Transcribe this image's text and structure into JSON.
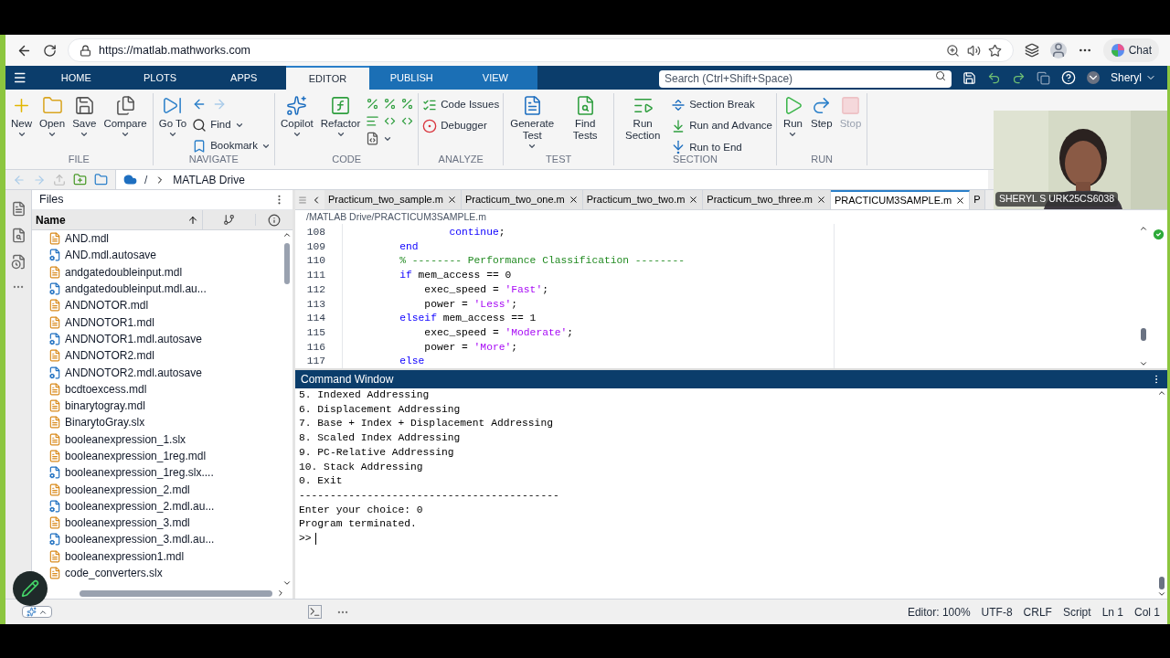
{
  "browser": {
    "url": "https://matlab.mathworks.com",
    "chat": "Chat"
  },
  "toolstrip": {
    "tabs": [
      {
        "label": "HOME",
        "selected": false,
        "contextual": false
      },
      {
        "label": "PLOTS",
        "selected": false,
        "contextual": false
      },
      {
        "label": "APPS",
        "selected": false,
        "contextual": false
      },
      {
        "label": "EDITOR",
        "selected": true,
        "contextual": true
      },
      {
        "label": "PUBLISH",
        "selected": false,
        "contextual": true
      },
      {
        "label": "VIEW",
        "selected": false,
        "contextual": true
      }
    ],
    "search": {
      "placeholder": "Search (Ctrl+Shift+Space)"
    },
    "user": "Sheryl"
  },
  "ribbon": [
    {
      "title": "FILE",
      "items": [
        {
          "kind": "large",
          "label": "New",
          "dropdown": true,
          "disabled": false
        },
        {
          "kind": "large",
          "label": "Open",
          "dropdown": true,
          "disabled": false
        },
        {
          "kind": "large",
          "label": "Save",
          "dropdown": true,
          "disabled": false
        },
        {
          "kind": "large",
          "label": "Compare",
          "dropdown": true,
          "disabled": false
        }
      ]
    },
    {
      "title": "NAVIGATE",
      "items": [
        {
          "kind": "large",
          "label": "Go To",
          "dropdown": true,
          "disabled": false
        },
        {
          "kind": "arrows",
          "dropdown": false,
          "disabled": false
        },
        {
          "kind": "small",
          "label": "Find",
          "dropdown": true,
          "disabled": false
        },
        {
          "kind": "small",
          "label": "Bookmark",
          "dropdown": true,
          "disabled": false
        }
      ]
    },
    {
      "title": "CODE",
      "items": [
        {
          "kind": "large",
          "label": "Copilot",
          "dropdown": true,
          "disabled": false
        },
        {
          "kind": "large",
          "label": "Refactor",
          "dropdown": true,
          "disabled": false
        },
        {
          "kind": "grid",
          "dropdown": true,
          "disabled": false
        }
      ]
    },
    {
      "title": "ANALYZE",
      "items": [
        {
          "kind": "small",
          "label": "Code Issues",
          "dropdown": false,
          "disabled": false
        },
        {
          "kind": "small",
          "label": "Debugger",
          "dropdown": false,
          "disabled": false
        }
      ]
    },
    {
      "title": "TEST",
      "items": [
        {
          "kind": "large",
          "label": "Generate Test",
          "dropdown": true,
          "disabled": false
        },
        {
          "kind": "large",
          "label": "Find Tests",
          "dropdown": false,
          "disabled": false
        }
      ]
    },
    {
      "title": "SECTION",
      "items": [
        {
          "kind": "large",
          "label": "Run Section",
          "dropdown": false,
          "disabled": false
        },
        {
          "kind": "small",
          "label": "Section Break",
          "dropdown": false,
          "disabled": false
        },
        {
          "kind": "small",
          "label": "Run and Advance",
          "dropdown": false,
          "disabled": false
        },
        {
          "kind": "small",
          "label": "Run to End",
          "dropdown": false,
          "disabled": false
        }
      ]
    },
    {
      "title": "RUN",
      "items": [
        {
          "kind": "large",
          "label": "Run",
          "dropdown": true,
          "disabled": false
        },
        {
          "kind": "large",
          "label": "Step",
          "dropdown": false,
          "disabled": false
        },
        {
          "kind": "large",
          "label": "Stop",
          "dropdown": false,
          "disabled": true
        }
      ]
    }
  ],
  "address": {
    "root": "/",
    "folder": "MATLAB Drive"
  },
  "files": {
    "title": "Files",
    "column": "Name",
    "items": [
      {
        "name": "AND.mdl",
        "kind": "model"
      },
      {
        "name": "AND.mdl.autosave",
        "kind": "autosave"
      },
      {
        "name": "andgatedoubleinput.mdl",
        "kind": "model"
      },
      {
        "name": "andgatedoubleinput.mdl.au...",
        "kind": "autosave"
      },
      {
        "name": "ANDNOTOR.mdl",
        "kind": "model"
      },
      {
        "name": "ANDNOTOR1.mdl",
        "kind": "model"
      },
      {
        "name": "ANDNOTOR1.mdl.autosave",
        "kind": "autosave"
      },
      {
        "name": "ANDNOTOR2.mdl",
        "kind": "model"
      },
      {
        "name": "ANDNOTOR2.mdl.autosave",
        "kind": "autosave"
      },
      {
        "name": "bcdtoexcess.mdl",
        "kind": "model"
      },
      {
        "name": "binarytogray.mdl",
        "kind": "model"
      },
      {
        "name": "BinarytoGray.slx",
        "kind": "model"
      },
      {
        "name": "booleanexpression_1.slx",
        "kind": "model"
      },
      {
        "name": "booleanexpression_1reg.mdl",
        "kind": "model"
      },
      {
        "name": "booleanexpression_1reg.slx....",
        "kind": "autosave"
      },
      {
        "name": "booleanexpression_2.mdl",
        "kind": "model"
      },
      {
        "name": "booleanexpression_2.mdl.au...",
        "kind": "autosave"
      },
      {
        "name": "booleanexpression_3.mdl",
        "kind": "model"
      },
      {
        "name": "booleanexpression_3.mdl.au...",
        "kind": "autosave"
      },
      {
        "name": "booleanexpression1.mdl",
        "kind": "model"
      },
      {
        "name": "code_converters.slx",
        "kind": "model"
      }
    ]
  },
  "editor": {
    "tabs": [
      {
        "label": "Practicum_two_sample.m",
        "selected": false
      },
      {
        "label": "Practicum_two_one.m",
        "selected": false
      },
      {
        "label": "Practicum_two_two.m",
        "selected": false
      },
      {
        "label": "Practicum_two_three.m",
        "selected": false
      },
      {
        "label": "PRACTICUM3SAMPLE.m",
        "selected": true
      },
      {
        "label": "P",
        "selected": false
      }
    ],
    "path": "/MATLAB Drive/PRACTICUM3SAMPLE.m",
    "lines": [
      {
        "number": "108",
        "segments": [
          {
            "kind": "keyword",
            "text": "                continue"
          },
          {
            "kind": "plain",
            "text": ";"
          }
        ]
      },
      {
        "number": "109",
        "segments": [
          {
            "kind": "keyword",
            "text": "        end"
          }
        ]
      },
      {
        "number": "110",
        "segments": [
          {
            "kind": "comment",
            "text": "        % -------- Performance Classification --------"
          }
        ]
      },
      {
        "number": "111",
        "segments": [
          {
            "kind": "keyword",
            "text": "        if"
          },
          {
            "kind": "plain",
            "text": " mem_access == 0"
          }
        ]
      },
      {
        "number": "112",
        "segments": [
          {
            "kind": "plain",
            "text": "            exec_speed = "
          },
          {
            "kind": "string",
            "text": "'Fast'"
          },
          {
            "kind": "plain",
            "text": ";"
          }
        ]
      },
      {
        "number": "113",
        "segments": [
          {
            "kind": "plain",
            "text": "            power = "
          },
          {
            "kind": "string",
            "text": "'Less'"
          },
          {
            "kind": "plain",
            "text": ";"
          }
        ]
      },
      {
        "number": "114",
        "segments": [
          {
            "kind": "keyword",
            "text": "        elseif"
          },
          {
            "kind": "plain",
            "text": " mem_access == 1"
          }
        ]
      },
      {
        "number": "115",
        "segments": [
          {
            "kind": "plain",
            "text": "            exec_speed = "
          },
          {
            "kind": "string",
            "text": "'Moderate'"
          },
          {
            "kind": "plain",
            "text": ";"
          }
        ]
      },
      {
        "number": "116",
        "segments": [
          {
            "kind": "plain",
            "text": "            power = "
          },
          {
            "kind": "string",
            "text": "'More'"
          },
          {
            "kind": "plain",
            "text": ";"
          }
        ]
      },
      {
        "number": "117",
        "segments": [
          {
            "kind": "keyword",
            "text": "        else"
          }
        ]
      }
    ]
  },
  "command_window": {
    "title": "Command Window",
    "lines": [
      "5. Indexed Addressing",
      "6. Displacement Addressing",
      "7. Base + Index + Displacement Addressing",
      "8. Scaled Index Addressing",
      "9. PC-Relative Addressing",
      "10. Stack Addressing",
      "0. Exit",
      "------------------------------------------",
      "Enter your choice: 0",
      "Program terminated."
    ],
    "prompt": ">>"
  },
  "status_bar": [
    "Editor: 100%",
    "UTF-8",
    "CRLF",
    "Script",
    "Ln 1",
    "Col 1"
  ],
  "webcam": {
    "kind": "picture",
    "caption": "SHERYL S URK25CS6038"
  }
}
